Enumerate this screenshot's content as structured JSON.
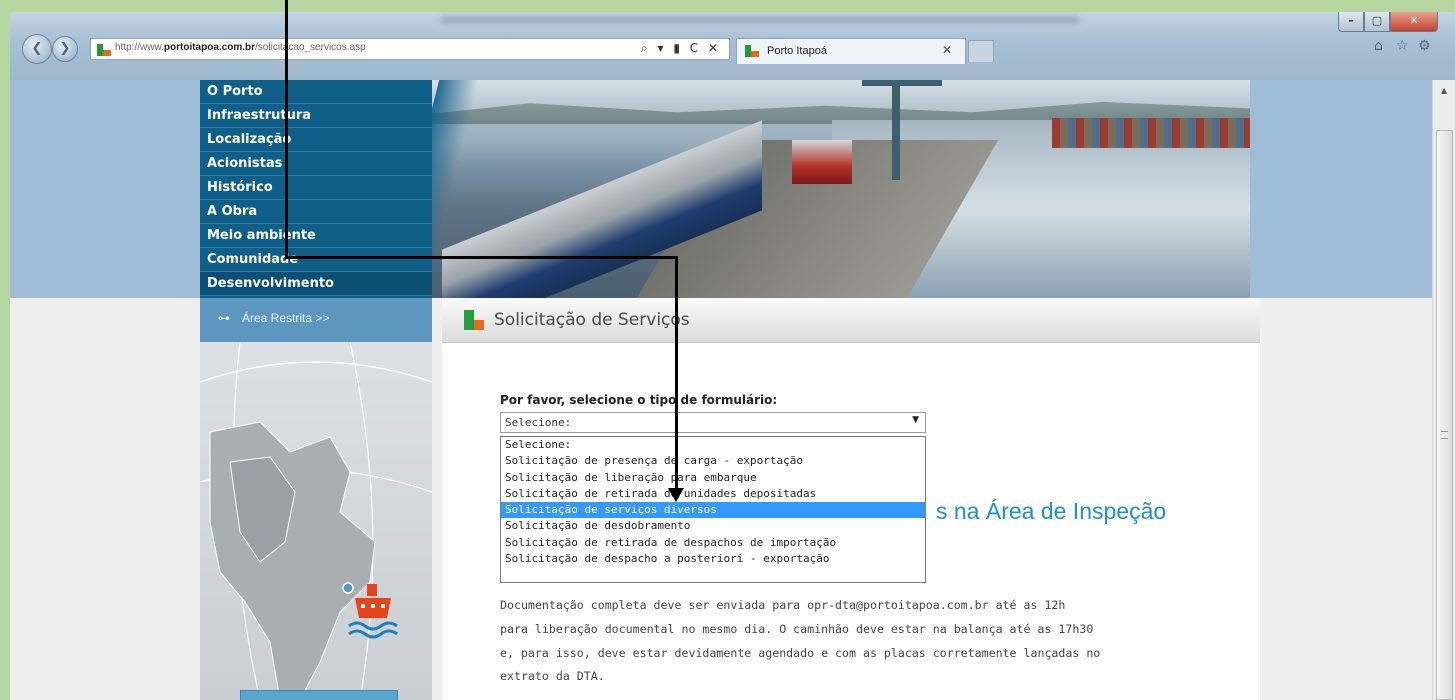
{
  "browser": {
    "url_prefix": "http://www.",
    "url_domain": "portoitapoa.com.br",
    "url_path": "/solicitacao_servicos.asp",
    "addr_tools": "⌕ ▾ ▮ C ✕",
    "tab_title": "Porto Itapoá",
    "tab_close": "✕",
    "win_min": "–",
    "win_max": "▢",
    "win_close": "✕",
    "back": "❮",
    "forward": "❯",
    "home_icon": "⌂",
    "favorites_icon": "☆",
    "settings_icon": "⚙"
  },
  "menu": {
    "items": [
      "O Porto",
      "Infraestrutura",
      "Localização",
      "Acionistas",
      "Histórico",
      " A Obra",
      "Meio ambiente",
      "Comunidade",
      "Desenvolvimento"
    ]
  },
  "restricted": {
    "key_icon": "⊶",
    "label": "Área Restrita >>"
  },
  "page": {
    "title": "Solicitação de Serviços",
    "form_label": "Por favor, selecione o tipo de formulário:",
    "select_value": "Selecione:",
    "select_caret": "▼",
    "options": [
      "Selecione:",
      "Solicitação de presença de carga - exportação",
      "Solicitação de liberação para embarque",
      "Solicitação de retirada de unidades depositadas",
      "Solicitação de serviços diversos",
      "Solicitação de desdobramento",
      "Solicitação de retirada de despachos de importação",
      "Solicitação de despacho a posteriori - exportação"
    ],
    "selected_index": 4,
    "section_title": "s na Área de Inspeção",
    "paragraph": [
      "Documentação completa deve ser enviada para opr-dta@portoitapoa.com.br até as 12h",
      "para liberação documental no mesmo dia. O caminhão deve estar na balança até as 17h30",
      "e, para isso, deve estar devidamente agendado e com as placas corretamente lançadas no",
      "extrato da DTA."
    ]
  }
}
